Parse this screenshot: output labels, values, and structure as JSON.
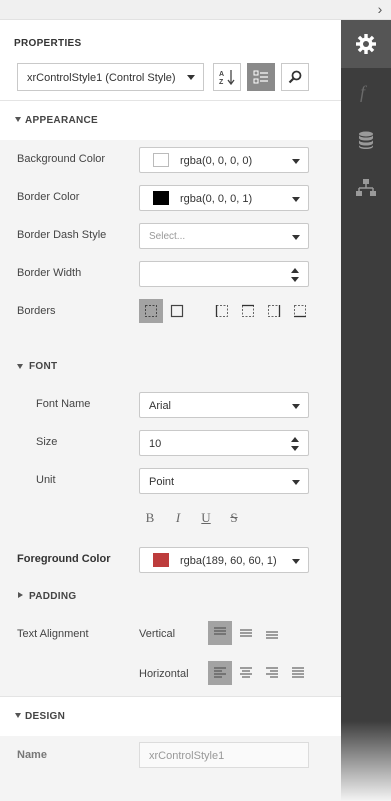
{
  "panel": {
    "title": "PROPERTIES",
    "style_select": "xrControlStyle1 (Control Style)",
    "sort_tooltip": "A Z",
    "categories_tooltip": "categories",
    "search_tooltip": "search"
  },
  "appearance": {
    "label": "APPEARANCE",
    "background_color": {
      "label": "Background Color",
      "value": "rgba(0, 0, 0, 0)",
      "swatch": "#ffffff"
    },
    "border_color": {
      "label": "Border Color",
      "value": "rgba(0, 0, 0, 1)",
      "swatch": "#000000"
    },
    "border_dash_style": {
      "label": "Border Dash Style",
      "placeholder": "Select..."
    },
    "border_width": {
      "label": "Border Width",
      "value": ""
    },
    "borders": {
      "label": "Borders"
    }
  },
  "font": {
    "label": "FONT",
    "font_name": {
      "label": "Font Name",
      "value": "Arial"
    },
    "size": {
      "label": "Size",
      "value": "10"
    },
    "unit": {
      "label": "Unit",
      "value": "Point"
    },
    "styles": [
      "B",
      "I",
      "U",
      "S"
    ]
  },
  "foreground_color": {
    "label": "Foreground Color",
    "value": "rgba(189, 60, 60, 1)",
    "swatch": "#bd3c3c"
  },
  "padding": {
    "label": "PADDING"
  },
  "text_alignment": {
    "label": "Text Alignment",
    "vertical_label": "Vertical",
    "horizontal_label": "Horizontal"
  },
  "design": {
    "label": "DESIGN",
    "name": {
      "label": "Name",
      "placeholder": "xrControlStyle1"
    }
  },
  "sidebar_tabs": [
    "gear-icon",
    "function-icon",
    "database-icon",
    "tree-icon"
  ],
  "colors": {
    "accent_strip": "#3d3d3d",
    "active_tab": "#555555"
  }
}
